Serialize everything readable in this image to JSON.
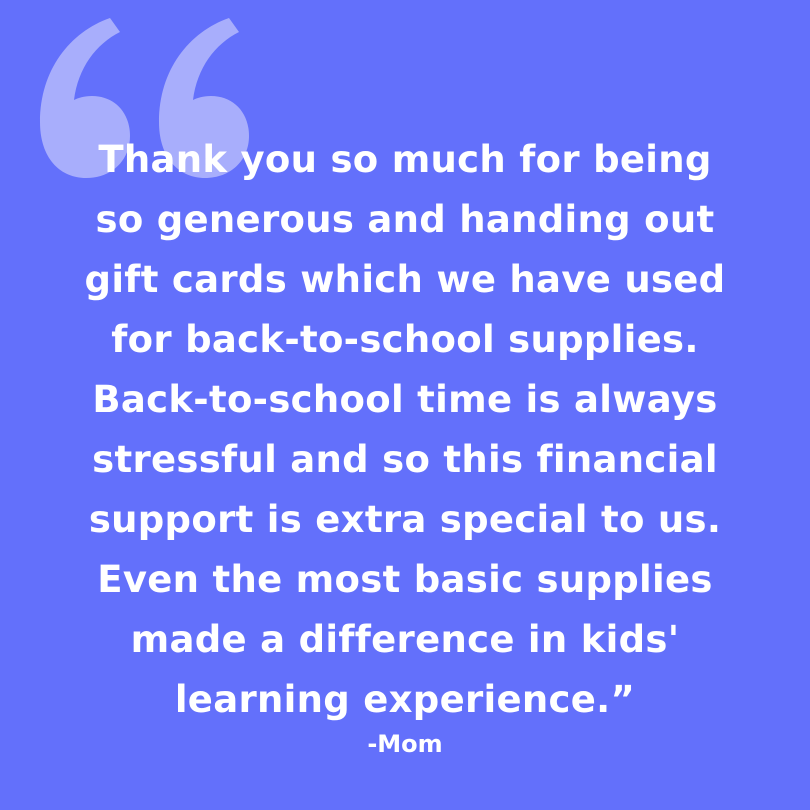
{
  "colors": {
    "background": "#6370fb",
    "text": "#ffffff",
    "quote_mark": "#a8aefc"
  },
  "decoration": {
    "icon": "opening-quote-icon"
  },
  "quote": {
    "lines": [
      "Thank you so much for being",
      "so generous and handing out",
      "gift cards which we have used",
      "for back-to-school supplies.",
      "Back-to-school time is always",
      "stressful and so this financial",
      "support is extra special to us.",
      "Even the most basic supplies",
      "made a difference in kids'",
      "learning experience.”"
    ],
    "attribution": "-Mom"
  }
}
